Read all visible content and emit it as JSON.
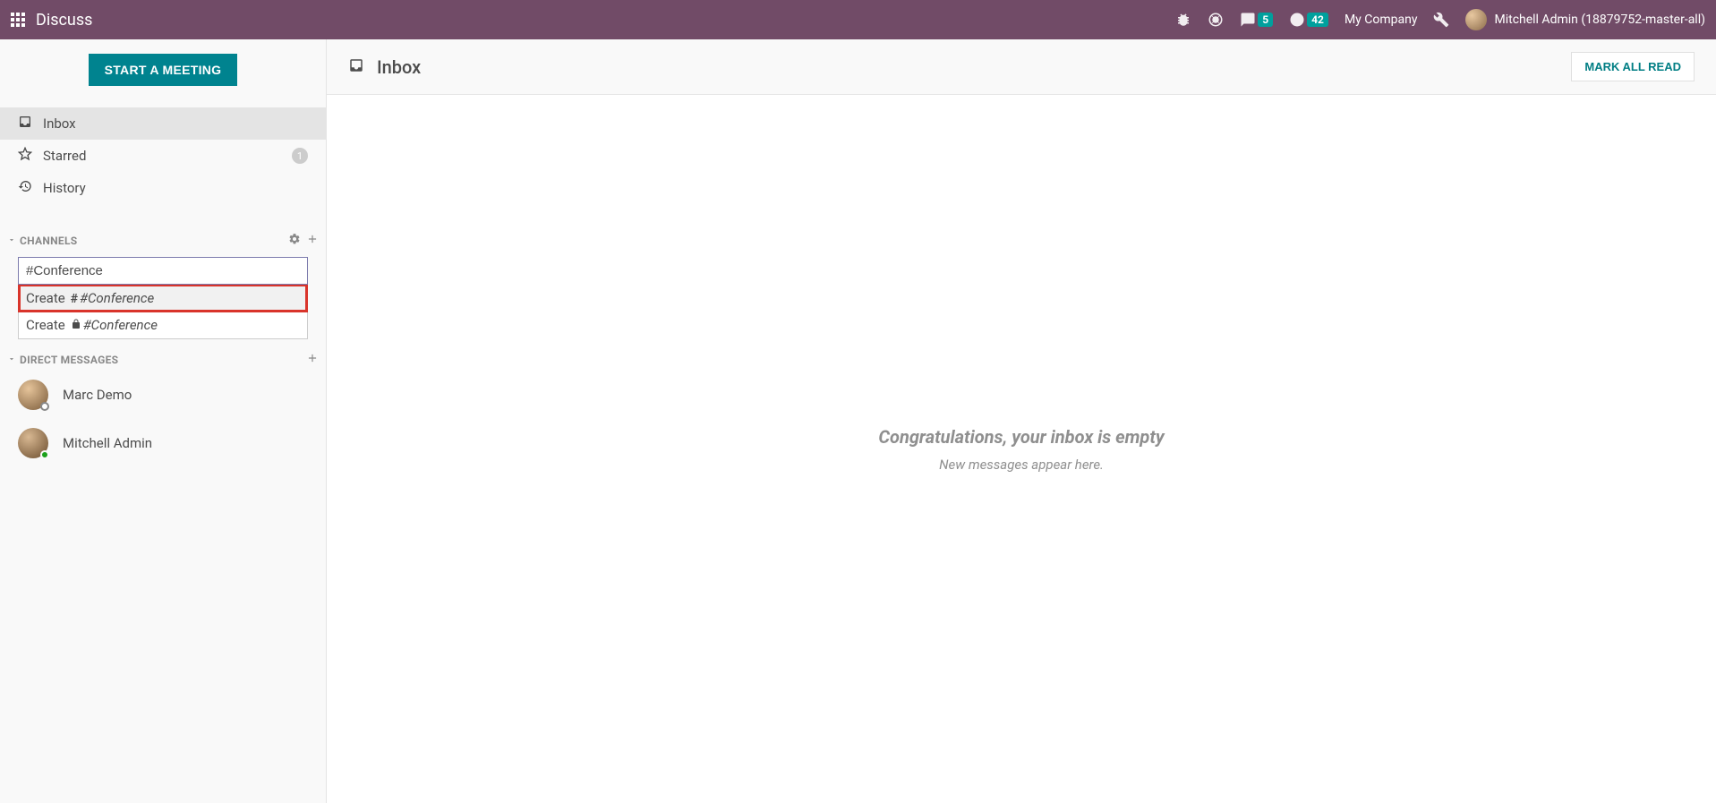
{
  "navbar": {
    "app_title": "Discuss",
    "messages_badge": "5",
    "activities_badge": "42",
    "company": "My Company",
    "user_name": "Mitchell Admin (18879752-master-all)"
  },
  "sidebar": {
    "meeting_button": "START A MEETING",
    "mailboxes": {
      "inbox": "Inbox",
      "starred": "Starred",
      "starred_count": "1",
      "history": "History"
    },
    "channels_header": "CHANNELS",
    "channel_input_value": "#Conference",
    "dropdown": {
      "create_label": "Create",
      "public_prefix": "#",
      "channel_name": "#Conference"
    },
    "dm_header": "DIRECT MESSAGES",
    "dm": [
      {
        "name": "Marc Demo",
        "status": "offline"
      },
      {
        "name": "Mitchell Admin",
        "status": "online"
      }
    ]
  },
  "main": {
    "title": "Inbox",
    "mark_all_read": "MARK ALL READ",
    "empty_heading": "Congratulations, your inbox is empty",
    "empty_sub": "New messages appear here."
  }
}
